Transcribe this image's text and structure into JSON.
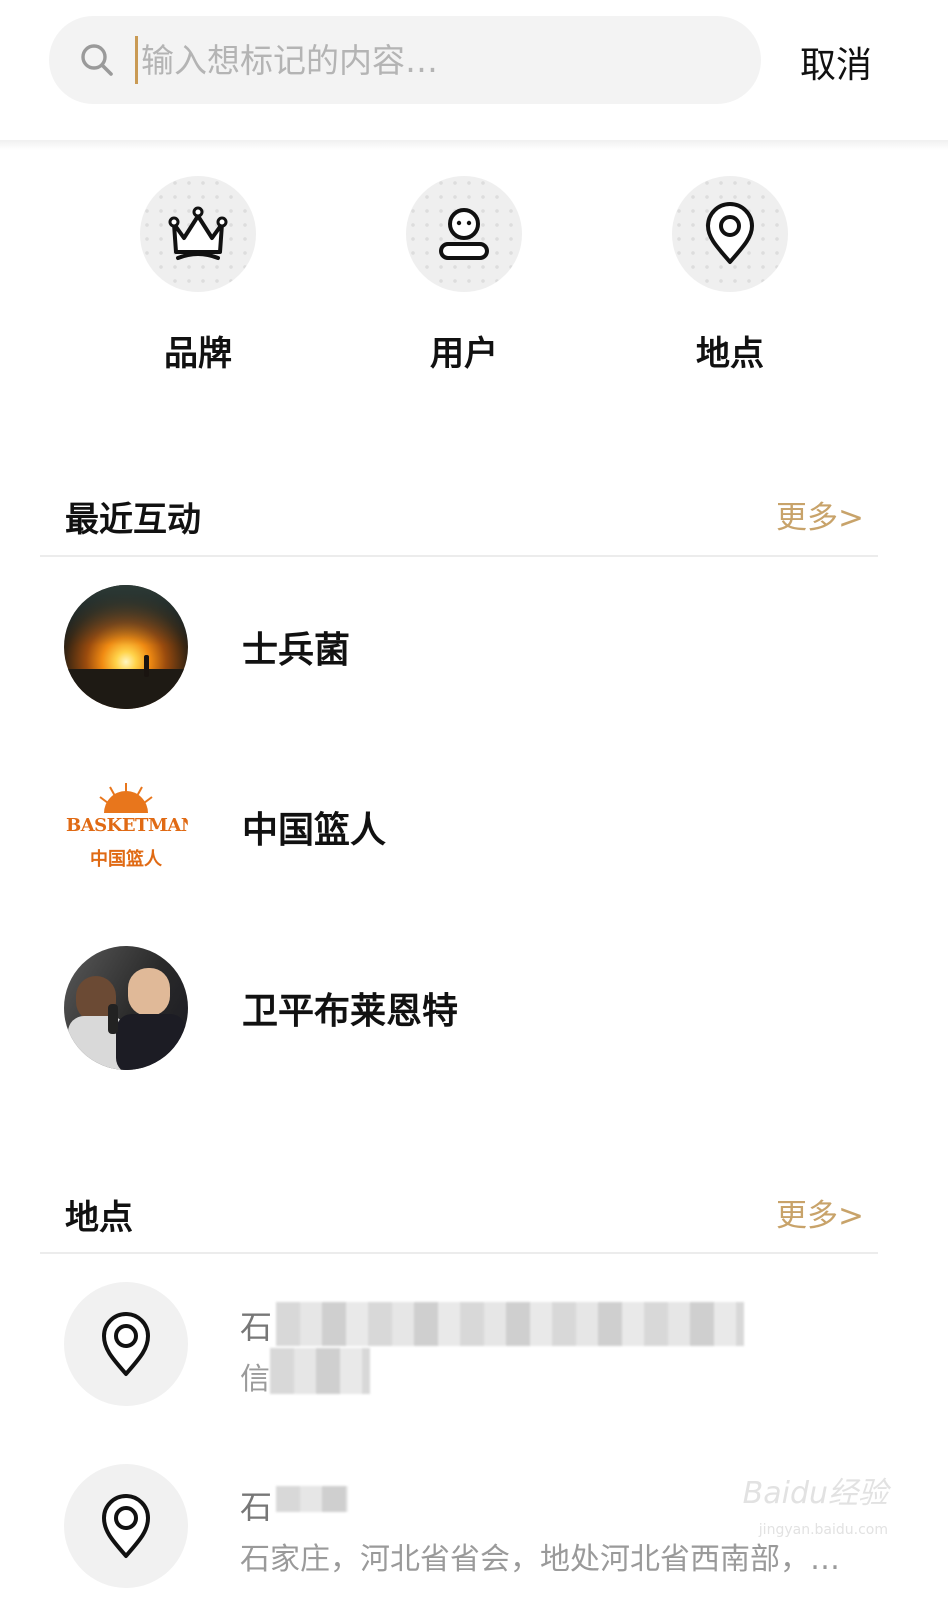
{
  "search": {
    "placeholder": "输入想标记的内容…",
    "value": "",
    "cancel_label": "取消"
  },
  "categories": [
    {
      "label": "品牌",
      "icon": "crown-icon"
    },
    {
      "label": "用户",
      "icon": "user-icon"
    },
    {
      "label": "地点",
      "icon": "location-pin-icon"
    }
  ],
  "recent": {
    "title": "最近互动",
    "more_label": "更多>",
    "items": [
      {
        "name": "士兵菌",
        "avatar": "sunset-photo"
      },
      {
        "name": "中国篮人",
        "avatar": "basketman-logo"
      },
      {
        "name": "卫平布莱恩特",
        "avatar": "people-photo"
      }
    ]
  },
  "places": {
    "title": "地点",
    "more_label": "更多>",
    "items": [
      {
        "title": "石",
        "desc": "信"
      },
      {
        "title": "石",
        "desc": "石家庄，河北省省会，地处河北省西南部，…"
      }
    ]
  },
  "logo_text": {
    "basketman": "BASKETMAN",
    "basketman_cn": "中国篮人"
  },
  "watermark": {
    "brand": "Baidu经验",
    "url": "jingyan.baidu.com"
  },
  "colors": {
    "accent": "#c8a36a",
    "caret": "#c99a54",
    "search_bg": "#f3f3f3"
  }
}
